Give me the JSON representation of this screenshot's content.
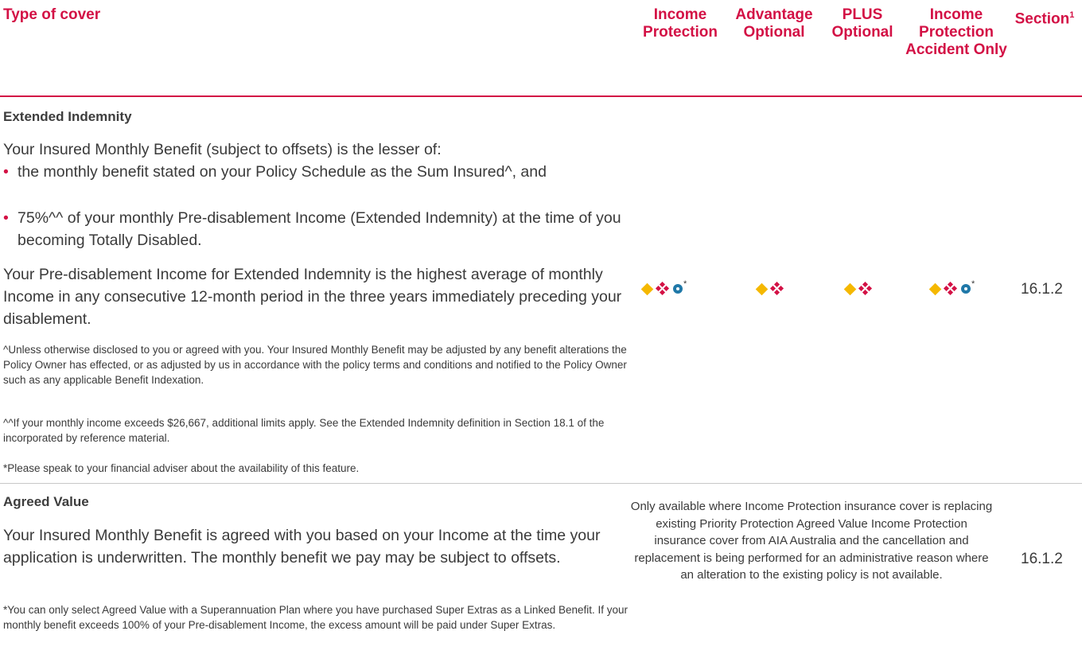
{
  "header": {
    "type_of_cover": "Type of cover",
    "col1": "Income Protection",
    "col2": "Advantage Optional",
    "col3": "PLUS Optional",
    "col4": "Income Protection Accident Only",
    "col5": "Section",
    "col5_sup": "1"
  },
  "extended": {
    "title": "Extended Indemnity",
    "intro": "Your Insured Monthly Benefit (subject to offsets) is the lesser of:",
    "bullet1": "the monthly benefit stated on your Policy Schedule as the Sum Insured^, and",
    "bullet2": "75%^^ of your monthly Pre-disablement Income (Extended Indemnity) at the time of you becoming Totally Disabled.",
    "para2": "Your Pre-disablement Income for Extended Indemnity is the highest average of monthly Income in any consecutive 12-month period in the three years immediately preceding your disablement.",
    "note1": "^Unless otherwise disclosed to you or agreed with you. Your Insured Monthly Benefit may be adjusted by any benefit alterations the Policy Owner has effected, or as adjusted by us in accordance with the policy terms and conditions and notified to the Policy Owner such as any applicable Benefit Indexation.",
    "note2": "^^If your monthly income exceeds $26,667, additional limits apply. See the Extended Indemnity definition in Section 18.1 of the incorporated by reference material.",
    "note3": "*Please speak to your financial adviser about the availability of this feature.",
    "asterisk": "*",
    "section": "16.1.2"
  },
  "agreed": {
    "title": "Agreed Value",
    "para": "Your Insured Monthly Benefit is agreed with you based on your Income at the time your application is underwritten. The monthly benefit we pay may be subject to offsets.",
    "note": "*You can only select Agreed Value with a Superannuation Plan where you have purchased Super Extras as a Linked Benefit. If your monthly benefit exceeds 100% of your Pre-disablement Income, the excess amount will be paid under Super Extras.",
    "availability": "Only available where Income Protection insurance cover is replacing existing Priority Protection Agreed Value Income Protection insurance cover from AIA Australia and the cancellation and replacement is being performed for an administrative reason where an alteration to the existing policy is not available.",
    "section": "16.1.2"
  },
  "colors": {
    "accent": "#d31145",
    "gold": "#f5b800",
    "blue": "#1f78a8"
  },
  "icons": {
    "diamond": "gold-diamond-icon",
    "cluster": "red-diamond-cluster-icon",
    "circle": "blue-circle-icon"
  }
}
